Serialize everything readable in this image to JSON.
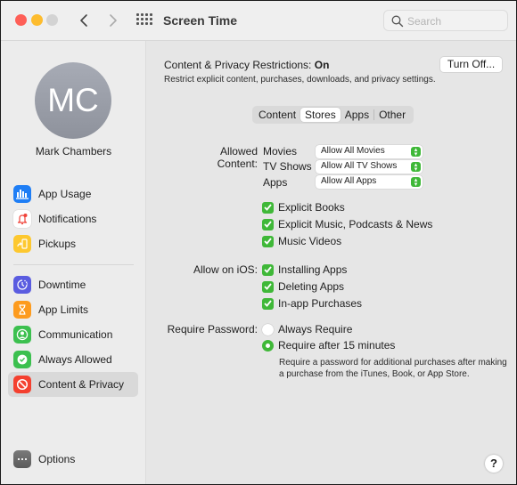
{
  "window": {
    "title": "Screen Time",
    "search_placeholder": "Search"
  },
  "sidebar": {
    "avatar_initials": "MC",
    "user_name": "Mark Chambers",
    "groups": [
      [
        {
          "label": "App Usage",
          "icon": "bar-chart-icon",
          "color": "#1f7ef5"
        },
        {
          "label": "Notifications",
          "icon": "bell-icon",
          "color": "#ffffff"
        },
        {
          "label": "Pickups",
          "icon": "pickup-phone-icon",
          "color": "#fdc82f"
        }
      ],
      [
        {
          "label": "Downtime",
          "icon": "downtime-icon",
          "color": "#5a5ce0"
        },
        {
          "label": "App Limits",
          "icon": "hourglass-icon",
          "color": "#fd9b1e"
        },
        {
          "label": "Communication",
          "icon": "person-circle-icon",
          "color": "#3cc04f"
        },
        {
          "label": "Always Allowed",
          "icon": "checkmark-seal-icon",
          "color": "#3cc04f"
        },
        {
          "label": "Content & Privacy",
          "icon": "prohibited-icon",
          "color": "#f4402f",
          "selected": true
        }
      ]
    ],
    "options_label": "Options"
  },
  "main": {
    "restrictions_label": "Content & Privacy Restrictions:",
    "restrictions_state": "On",
    "restrictions_desc": "Restrict explicit content, purchases, downloads, and privacy settings.",
    "turn_off_label": "Turn Off...",
    "tabs": [
      {
        "label": "Content",
        "active": false
      },
      {
        "label": "Stores",
        "active": true
      },
      {
        "label": "Apps",
        "active": false
      },
      {
        "label": "Other",
        "active": false
      }
    ],
    "allowed_content": {
      "label": "Allowed Content:",
      "rows": [
        {
          "label": "Movies",
          "value": "Allow All Movies"
        },
        {
          "label": "TV Shows",
          "value": "Allow All TV Shows"
        },
        {
          "label": "Apps",
          "value": "Allow All Apps"
        }
      ],
      "checkboxes": [
        {
          "label": "Explicit Books",
          "checked": true
        },
        {
          "label": "Explicit Music, Podcasts & News",
          "checked": true
        },
        {
          "label": "Music Videos",
          "checked": true
        }
      ]
    },
    "allow_on_ios": {
      "label": "Allow on iOS:",
      "checkboxes": [
        {
          "label": "Installing Apps",
          "checked": true
        },
        {
          "label": "Deleting Apps",
          "checked": true
        },
        {
          "label": "In-app Purchases",
          "checked": true
        }
      ]
    },
    "require_password": {
      "label": "Require Password:",
      "options": [
        {
          "label": "Always Require",
          "selected": false
        },
        {
          "label": "Require after 15 minutes",
          "selected": true
        }
      ],
      "description": "Require a password for additional purchases after making a purchase from the iTunes, Book, or App Store."
    },
    "help_label": "?"
  },
  "colors": {
    "accent_green": "#3fb838",
    "close": "#fe5f57",
    "minimize": "#fdbc2e",
    "maximize_disabled": "#d3d3d3"
  }
}
